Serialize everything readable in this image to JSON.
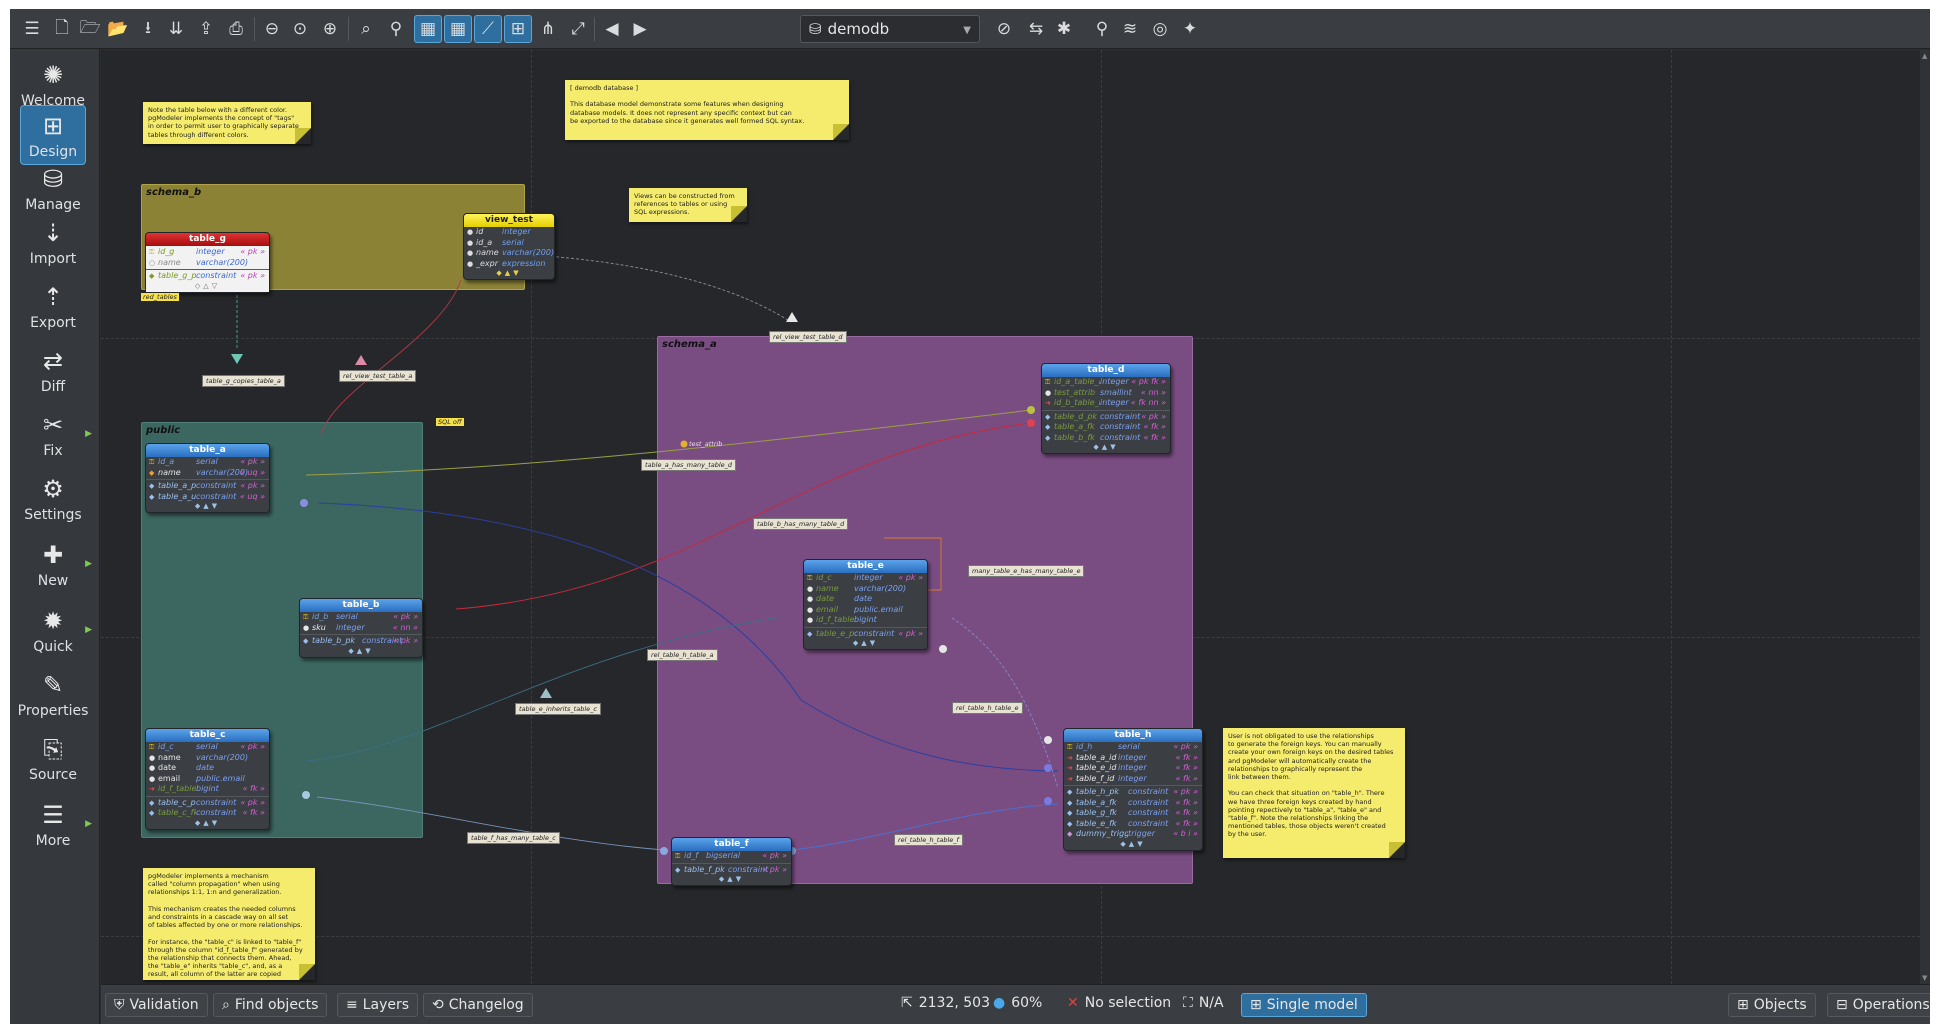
{
  "toolbar": {
    "buttons": [
      "menu-icon",
      "new-model-icon",
      "open-model-icon",
      "open-folder-icon",
      "save-icon",
      "save-all-icon",
      "export-icon",
      "print-icon",
      "zoom-out-icon",
      "zoom-normal-icon",
      "zoom-in-icon",
      "find-icon",
      "compare-icon",
      "grid-icon",
      "align-grid-icon",
      "magnetic-icon",
      "overview-icon",
      "relations-icon",
      "expand-icon",
      "back-icon",
      "forward-icon"
    ],
    "database": "demodb"
  },
  "sidebar": {
    "items": [
      {
        "label": "Welcome",
        "icon": "welcome-icon"
      },
      {
        "label": "Design",
        "icon": "design-icon"
      },
      {
        "label": "Manage",
        "icon": "manage-icon"
      },
      {
        "label": "Import",
        "icon": "import-icon"
      },
      {
        "label": "Export",
        "icon": "export-icon"
      },
      {
        "label": "Diff",
        "icon": "diff-icon"
      },
      {
        "label": "Fix",
        "icon": "fix-icon"
      },
      {
        "label": "Settings",
        "icon": "settings-icon"
      },
      {
        "label": "New",
        "icon": "new-icon"
      },
      {
        "label": "Quick",
        "icon": "quick-icon"
      },
      {
        "label": "Properties",
        "icon": "properties-icon"
      },
      {
        "label": "Source",
        "icon": "source-icon"
      },
      {
        "label": "More",
        "icon": "more-icon"
      }
    ]
  },
  "model": {
    "schemas": {
      "schema_b": "schema_b",
      "schema_a": "schema_a",
      "public": "public",
      "sql_off": "SQL off"
    },
    "tag": "red_tables",
    "tables": {
      "table_g": {
        "title": "table_g",
        "cols": [
          [
            "id_g",
            "integer",
            "« pk »"
          ],
          [
            "name",
            "varchar(200)",
            ""
          ],
          [
            "table_g_pk",
            "constraint",
            "« pk »"
          ]
        ]
      },
      "view_test": {
        "title": "view_test",
        "cols": [
          [
            "id",
            "integer",
            ""
          ],
          [
            "id_a",
            "serial",
            ""
          ],
          [
            "name",
            "varchar(200)",
            ""
          ],
          [
            "_expr",
            "expression",
            ""
          ]
        ]
      },
      "table_a": {
        "title": "table_a",
        "cols": [
          [
            "id_a",
            "serial",
            "« pk »"
          ],
          [
            "name",
            "varchar(200)",
            "« uq »"
          ],
          [
            "table_a_pk",
            "constraint",
            "« pk »"
          ],
          [
            "table_a_uq",
            "constraint",
            "« uq »"
          ]
        ]
      },
      "table_b": {
        "title": "table_b",
        "cols": [
          [
            "id_b",
            "serial",
            "« pk »"
          ],
          [
            "sku",
            "integer",
            "« nn »"
          ],
          [
            "table_b_pk",
            "constraint",
            "« pk »"
          ]
        ]
      },
      "table_c": {
        "title": "table_c",
        "cols": [
          [
            "id_c",
            "serial",
            "« pk »"
          ],
          [
            "name",
            "varchar(200)",
            ""
          ],
          [
            "date",
            "date",
            ""
          ],
          [
            "email",
            "public.email",
            ""
          ],
          [
            "id_f_table_f",
            "bigint",
            "« fk »"
          ],
          [
            "table_c_pk",
            "constraint",
            "« pk »"
          ],
          [
            "table_c_fk",
            "constraint",
            "« fk »"
          ]
        ]
      },
      "table_d": {
        "title": "table_d",
        "cols": [
          [
            "id_a_table_a",
            "integer",
            "« pk fk »"
          ],
          [
            "test_attrib",
            "smallint",
            "« nn »"
          ],
          [
            "id_b_table_b",
            "integer",
            "« fk nn »"
          ],
          [
            "table_d_pk",
            "constraint",
            "« pk »"
          ],
          [
            "table_a_fk",
            "constraint",
            "« fk »"
          ],
          [
            "table_b_fk",
            "constraint",
            "« fk »"
          ]
        ]
      },
      "table_e": {
        "title": "table_e",
        "cols": [
          [
            "id_c",
            "integer",
            "« pk »"
          ],
          [
            "name",
            "varchar(200)",
            ""
          ],
          [
            "date",
            "date",
            ""
          ],
          [
            "email",
            "public.email",
            ""
          ],
          [
            "id_f_table_f",
            "bigint",
            ""
          ],
          [
            "table_e_pk",
            "constraint",
            "« pk »"
          ]
        ]
      },
      "table_f": {
        "title": "table_f",
        "cols": [
          [
            "id_f",
            "bigserial",
            "« pk »"
          ],
          [
            "table_f_pk",
            "constraint",
            "« pk »"
          ]
        ]
      },
      "table_h": {
        "title": "table_h",
        "cols": [
          [
            "id_h",
            "serial",
            "« pk »"
          ],
          [
            "table_a_id",
            "integer",
            "« fk »"
          ],
          [
            "table_e_id",
            "integer",
            "« fk »"
          ],
          [
            "table_f_id",
            "integer",
            "« fk »"
          ],
          [
            "table_h_pk",
            "constraint",
            "« pk »"
          ],
          [
            "table_a_fk",
            "constraint",
            "« fk »"
          ],
          [
            "table_g_fk",
            "constraint",
            "« fk »"
          ],
          [
            "table_e_fk",
            "constraint",
            "« fk »"
          ],
          [
            "dummy_trigger",
            "trigger",
            "« b i »"
          ]
        ]
      }
    },
    "relationships": {
      "rel_view_test_table_d": "rel_view_test_table_d",
      "table_g_copies_table_a": "table_g_copies_table_a",
      "rel_view_test_table_a": "rel_view_test_table_a",
      "table_a_has_many_table_d": "table_a_has_many_table_d",
      "table_b_has_many_table_d": "table_b_has_many_table_d",
      "many_table_e_has_many_table_e": "many_table_e_has_many_table_e",
      "rel_table_h_table_a": "rel_table_h_table_a",
      "table_e_inherits_table_c": "table_e_inherits_table_c",
      "rel_table_h_table_e": "rel_table_h_table_e",
      "table_f_has_many_table_c": "table_f_has_many_table_c",
      "rel_table_h_table_f": "rel_table_h_table_f",
      "test_attrib": "test_attrib"
    },
    "notes": {
      "note_tags": "Note the table below with a different color.\npgModeler implements the concept of \"tags\"\nin order to permit user to graphically separate\ntables through different colors.",
      "note_demodb": "[ demodb database ]\n\nThis database model demonstrate some features when designing\ndatabase models. It does not represent any specific context but can\nbe exported to the database since it generates well formed SQL syntax.",
      "note_views": "Views can be constructed from\nreferences to tables or using\nSQL expressions.",
      "note_fk": "User is not obligated to use the relationships\nto generate the foreign keys. You can manually\ncreate your own foreign keys on the desired tables\nand pgModeler will automatically create the\nrelationships to graphically represent the\nlink between them.\n\nYou can check that situation on \"table_h\". There\nwe have three foreign keys created by hand\npointing repectively to \"table_a\", \"table_e\" and\n\"table_f\". Note the relationships linking the\nmentioned tables, those objects weren't created\nby the user.",
      "note_propagation": "pgModeler implements a mechanism\ncalled \"column propagation\" when using\nrelationships 1:1, 1:n and generalization.\n\nThis mechanism creates the needed columns\nand constraints in a cascade way on all set\nof tables affected by one or more relationships.\n\nFor instance, the \"table_c\" is linked to \"table_f\"\nthrough the column \"id_f_table_f\" generated by\nthe relationship that connects them. Ahead,\nthe \"table_e\" inherits \"table_c\", and, as a\nresult, all column of the latter are copied"
    }
  },
  "statusbar": {
    "validation": "Validation",
    "find_objects": "Find objects",
    "layers": "Layers",
    "changelog": "Changelog",
    "position": "2132, 503",
    "zoom": "60%",
    "selection": "No selection",
    "na": "N/A",
    "single_model": "Single model",
    "objects": "Objects",
    "operations": "Operations"
  },
  "colors": {
    "accent": "#2f6f9f",
    "schema_b": "#8b8236",
    "schema_a": "#7a4d82",
    "public": "#3c6660",
    "note": "#f5ec6e"
  }
}
